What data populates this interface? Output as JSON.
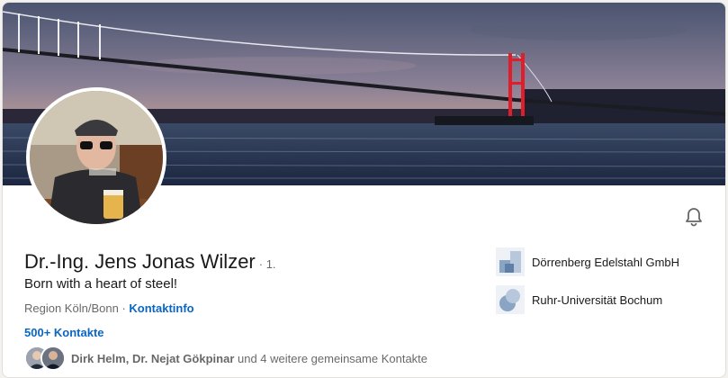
{
  "profile": {
    "name": "Dr.-Ing. Jens Jonas Wilzer",
    "degree": "· 1.",
    "headline": "Born with a heart of steel!",
    "location": "Region Köln/Bonn",
    "separator": "·",
    "contact_info_label": "Kontaktinfo",
    "connections_label": "500+ Kontakte"
  },
  "mutual": {
    "name_1": "Dirk Helm",
    "comma": ",",
    "name_2": "Dr. Nejat Gökpinar",
    "suffix": "und 4 weitere gemeinsame Kontakte"
  },
  "organizations": [
    {
      "name": "Dörrenberg Edelstahl GmbH",
      "logo": "dorrenberg-logo"
    },
    {
      "name": "Ruhr-Universität Bochum",
      "logo": "rub-logo"
    }
  ],
  "icons": {
    "bell": "bell-icon"
  },
  "colors": {
    "link": "#0a66c2",
    "secondary_text": "#666666",
    "bridge_light": "#e11d2a"
  }
}
